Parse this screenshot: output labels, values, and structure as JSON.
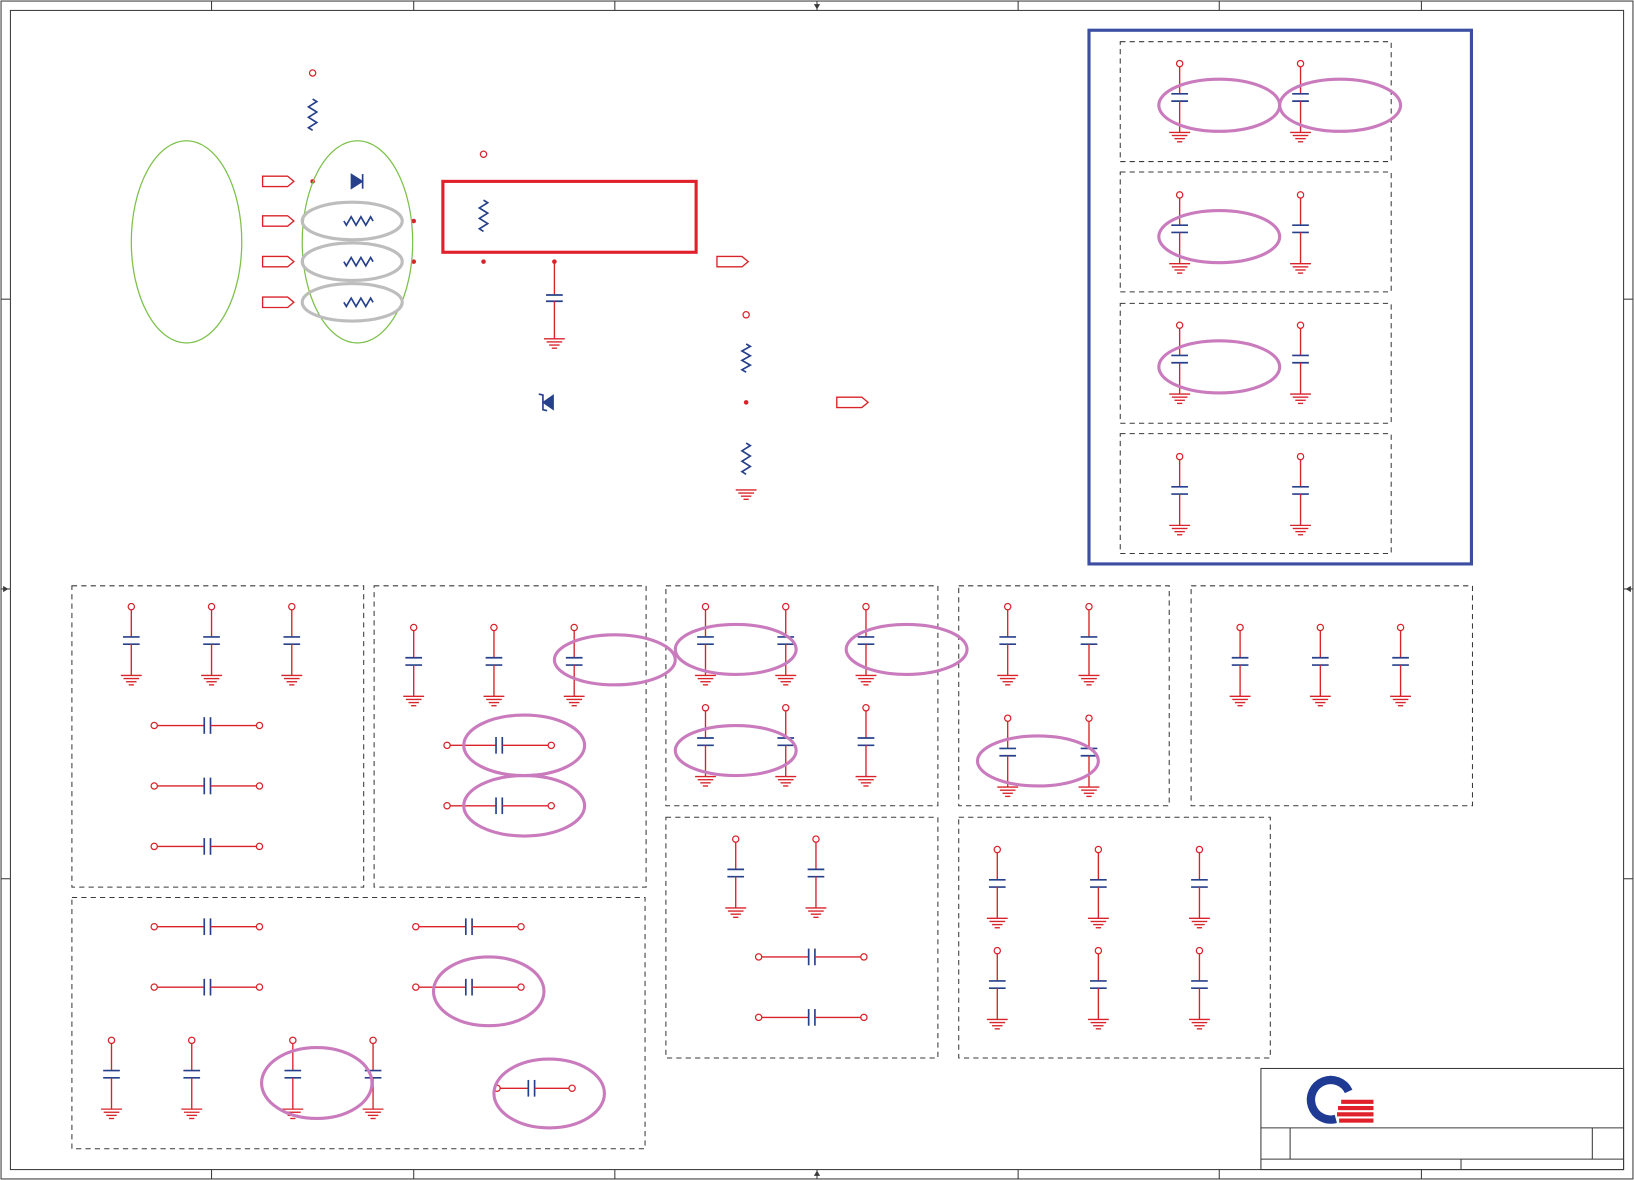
{
  "colors": {
    "wire": "#d8232a",
    "component": "#27408b",
    "frame": "#3a3a3a",
    "highlight_green": "#7cc04a",
    "highlight_grey": "#bdbdbd",
    "highlight_pink": "#c97bbd",
    "callout_red": "#e0212b",
    "group_blue": "#3b4ea2",
    "logo_blue": "#1f3a93",
    "logo_red": "#e0212b"
  },
  "icons": {
    "logo": "company-logo-icon",
    "capacitor": "capacitor-icon",
    "resistor": "resistor-icon",
    "diode": "diode-icon",
    "zener_diode": "zener-diode-icon",
    "ground": "ground-icon",
    "power_node": "power-node-icon",
    "off_page_connector": "off-page-connector-icon"
  }
}
